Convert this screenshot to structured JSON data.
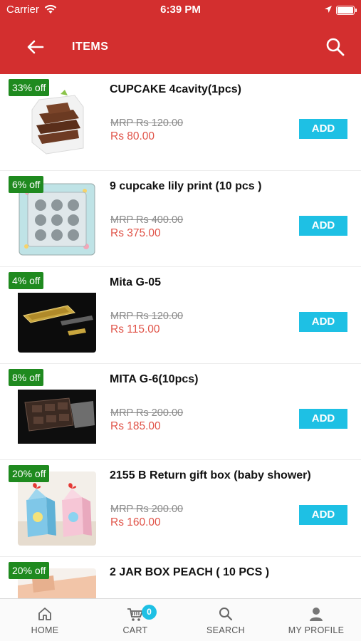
{
  "status": {
    "carrier": "Carrier",
    "time": "6:39 PM"
  },
  "header": {
    "title": "ITEMS",
    "back_icon": "arrow-left-icon",
    "search_icon": "search-icon"
  },
  "colors": {
    "primary": "#d32f2f",
    "accent": "#1ec0e4",
    "badge": "#1f8a1f",
    "price": "#e05348"
  },
  "items": [
    {
      "discount": "33% off",
      "name": "CUPCAKE 4cavity(1pcs)",
      "mrp": "MRP Rs 120.00",
      "price": "Rs 80.00",
      "add_label": "ADD",
      "image": "chocolate-brownie-stack"
    },
    {
      "discount": "6% off",
      "name": "9 cupcake lily print (10 pcs )",
      "mrp": "MRP Rs 400.00",
      "price": "Rs 375.00",
      "add_label": "ADD",
      "image": "floral-cupcake-box"
    },
    {
      "discount": "4% off",
      "name": "Mita G-05",
      "mrp": "MRP Rs 120.00",
      "price": "Rs 115.00",
      "add_label": "ADD",
      "image": "gold-tray"
    },
    {
      "discount": "8% off",
      "name": "MITA G-6(10pcs)",
      "mrp": "MRP Rs 200.00",
      "price": "Rs 185.00",
      "add_label": "ADD",
      "image": "brown-tray"
    },
    {
      "discount": "20% off",
      "name": "2155 B Return gift box (baby shower)",
      "mrp": "MRP Rs 200.00",
      "price": "Rs 160.00",
      "add_label": "ADD",
      "image": "gift-boxes"
    },
    {
      "discount": "20% off",
      "name": "2 JAR BOX PEACH ( 10 PCS )",
      "mrp": "",
      "price": "",
      "add_label": "",
      "image": "peach-box"
    }
  ],
  "tabbar": {
    "tabs": [
      {
        "label": "HOME",
        "icon": "home-icon"
      },
      {
        "label": "CART",
        "icon": "cart-icon",
        "badge": "0"
      },
      {
        "label": "SEARCH",
        "icon": "search-icon"
      },
      {
        "label": "MY PROFILE",
        "icon": "profile-icon"
      }
    ]
  }
}
